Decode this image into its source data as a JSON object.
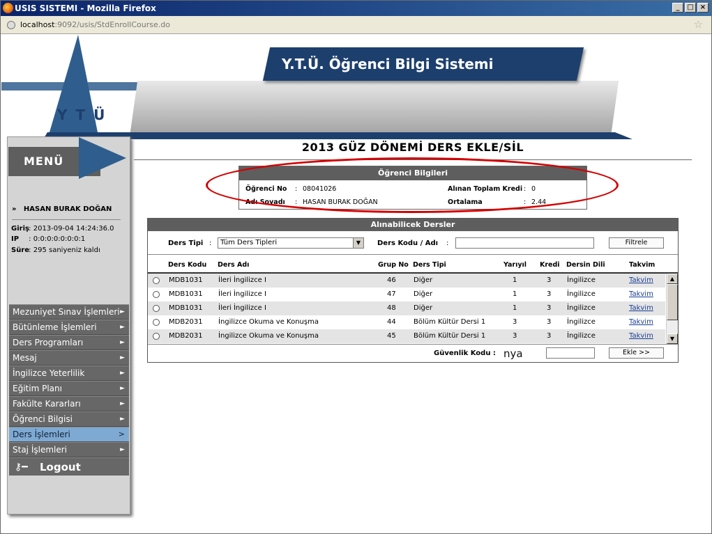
{
  "window": {
    "title": "USIS SISTEMI - Mozilla Firefox",
    "url_host": "localhost",
    "url_rest": ":9092/usis/StdEnrollCourse.do"
  },
  "banner": {
    "title": "Y.T.Ü. Öğrenci Bilgi Sistemi",
    "logo": "YTÜ"
  },
  "menu": {
    "title": "MENÜ",
    "user": "HASAN BURAK DOĞAN",
    "login_label": "Giriş",
    "login_value": "2013-09-04 14:24:36.0",
    "ip_label": "IP",
    "ip_value": "0:0:0:0:0:0:0:1",
    "time_label": "Süre",
    "time_value": "295 saniyeniz kaldı",
    "items": [
      {
        "label": "Mezuniyet Sınav İşlemleri"
      },
      {
        "label": "Bütünleme İşlemleri"
      },
      {
        "label": "Ders Programları"
      },
      {
        "label": "Mesaj"
      },
      {
        "label": "İngilizce Yeterlilik"
      },
      {
        "label": "Eğitim Planı"
      },
      {
        "label": "Fakülte Kararları"
      },
      {
        "label": "Öğrenci Bilgisi"
      },
      {
        "label": "Ders İşlemleri"
      },
      {
        "label": "Staj İşlemleri"
      }
    ],
    "logout": "Logout"
  },
  "page_title": "2013 GÜZ DÖNEMİ DERS EKLE/SİL",
  "student": {
    "header": "Öğrenci Bilgileri",
    "no_label": "Öğrenci No",
    "no_value": "08041026",
    "name_label": "Adı Soyadı",
    "name_value": "HASAN BURAK DOĞAN",
    "credit_label": "Alınan Toplam Kredi",
    "credit_value": "0",
    "avg_label": "Ortalama",
    "avg_value": "2.44",
    "colon": ":"
  },
  "courses": {
    "header": "Alınabilicek Dersler",
    "filter_type_label": "Ders Tipi",
    "filter_type_value": "Tüm Ders Tipleri",
    "filter_code_label": "Ders Kodu / Adı",
    "filter_button": "Filtrele",
    "columns": {
      "code": "Ders Kodu",
      "name": "Ders Adı",
      "group": "Grup No",
      "type": "Ders Tipi",
      "term": "Yarıyıl",
      "credit": "Kredi",
      "lang": "Dersin Dili",
      "cal": "Takvim"
    },
    "rows": [
      {
        "code": "MDB1031",
        "name": "İleri İngilizce I",
        "group": "46",
        "type": "Diğer",
        "term": "1",
        "credit": "3",
        "lang": "İngilizce",
        "cal": "Takvim"
      },
      {
        "code": "MDB1031",
        "name": "İleri İngilizce I",
        "group": "47",
        "type": "Diğer",
        "term": "1",
        "credit": "3",
        "lang": "İngilizce",
        "cal": "Takvim"
      },
      {
        "code": "MDB1031",
        "name": "İleri İngilizce I",
        "group": "48",
        "type": "Diğer",
        "term": "1",
        "credit": "3",
        "lang": "İngilizce",
        "cal": "Takvim"
      },
      {
        "code": "MDB2031",
        "name": "İngilizce Okuma ve Konuşma",
        "group": "44",
        "type": "Bölüm Kültür Dersi 1",
        "term": "3",
        "credit": "3",
        "lang": "İngilizce",
        "cal": "Takvim"
      },
      {
        "code": "MDB2031",
        "name": "İngilizce Okuma ve Konuşma",
        "group": "45",
        "type": "Bölüm Kültür Dersi 1",
        "term": "3",
        "credit": "3",
        "lang": "İngilizce",
        "cal": "Takvim"
      }
    ],
    "security_label": "Güvenlik Kodu :",
    "captcha": "nya",
    "add_button": "Ekle >>"
  },
  "colors": {
    "accent": "#1d3f6e",
    "menu_active": "#7ea9d3",
    "highlight_oval": "#d40000"
  }
}
